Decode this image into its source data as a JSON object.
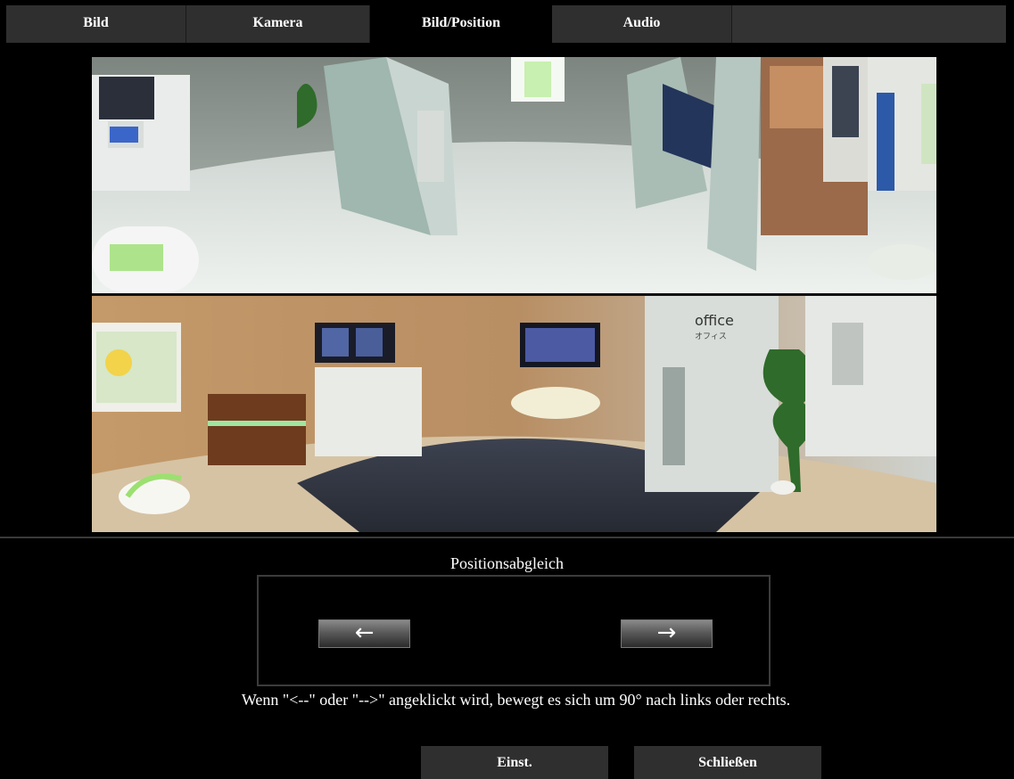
{
  "tabs": [
    {
      "label": "Bild",
      "active": false
    },
    {
      "label": "Kamera",
      "active": false
    },
    {
      "label": "Bild/Position",
      "active": true
    },
    {
      "label": "Audio",
      "active": false
    }
  ],
  "camera_view": {
    "sign_text": "office",
    "sign_subtext": "オフィス"
  },
  "position": {
    "title": "Positionsabgleich",
    "left_label": "←",
    "right_label": "→",
    "hint": "Wenn \"<--\" oder \"-->\" angeklickt wird, bewegt es sich um 90° nach links oder rechts."
  },
  "buttons": {
    "set": "Einst.",
    "close": "Schließen"
  },
  "colors": {
    "background": "#000000",
    "tab_bg": "#2f2f2f",
    "button_bg": "#2f2f2f"
  }
}
